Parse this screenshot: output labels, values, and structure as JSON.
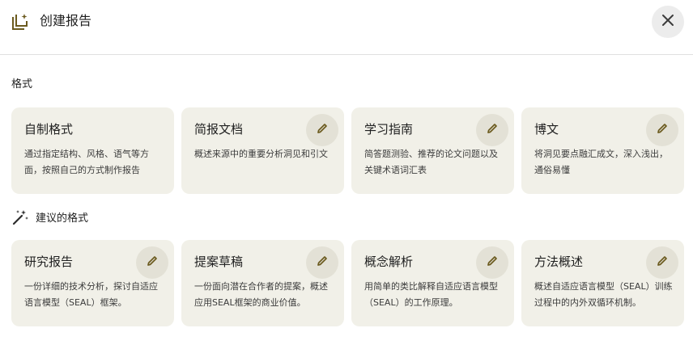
{
  "header": {
    "title": "创建报告",
    "icon": "report-add-icon",
    "close_icon": "close-icon"
  },
  "sections": {
    "formats_title": "格式",
    "suggested_title": "建议的格式",
    "suggested_icon": "magic-wand-icon"
  },
  "formats": [
    {
      "title": "自制格式",
      "desc": "通过指定结构、风格、语气等方面，按照自己的方式制作报告",
      "editable": false
    },
    {
      "title": "简报文档",
      "desc": "概述来源中的重要分析洞见和引文",
      "editable": true
    },
    {
      "title": "学习指南",
      "desc": "简答题测验、推荐的论文问题以及关键术语词汇表",
      "editable": true
    },
    {
      "title": "博文",
      "desc": "将洞见要点融汇成文，深入浅出，通俗易懂",
      "editable": true
    }
  ],
  "suggested": [
    {
      "title": "研究报告",
      "desc": "一份详细的技术分析，探讨自适应语言模型（SEAL）框架。",
      "editable": true
    },
    {
      "title": "提案草稿",
      "desc": "一份面向潜在合作者的提案，概述应用SEAL框架的商业价值。",
      "editable": true
    },
    {
      "title": "概念解析",
      "desc": "用简单的类比解释自适应语言模型（SEAL）的工作原理。",
      "editable": true
    },
    {
      "title": "方法概述",
      "desc": "概述自适应语言模型（SEAL）训练过程中的内外双循环机制。",
      "editable": true
    }
  ],
  "colors": {
    "card_bg": "#f1f0e8",
    "edit_btn_bg": "#e3e1d6",
    "icon_olive": "#6b5a1e"
  }
}
